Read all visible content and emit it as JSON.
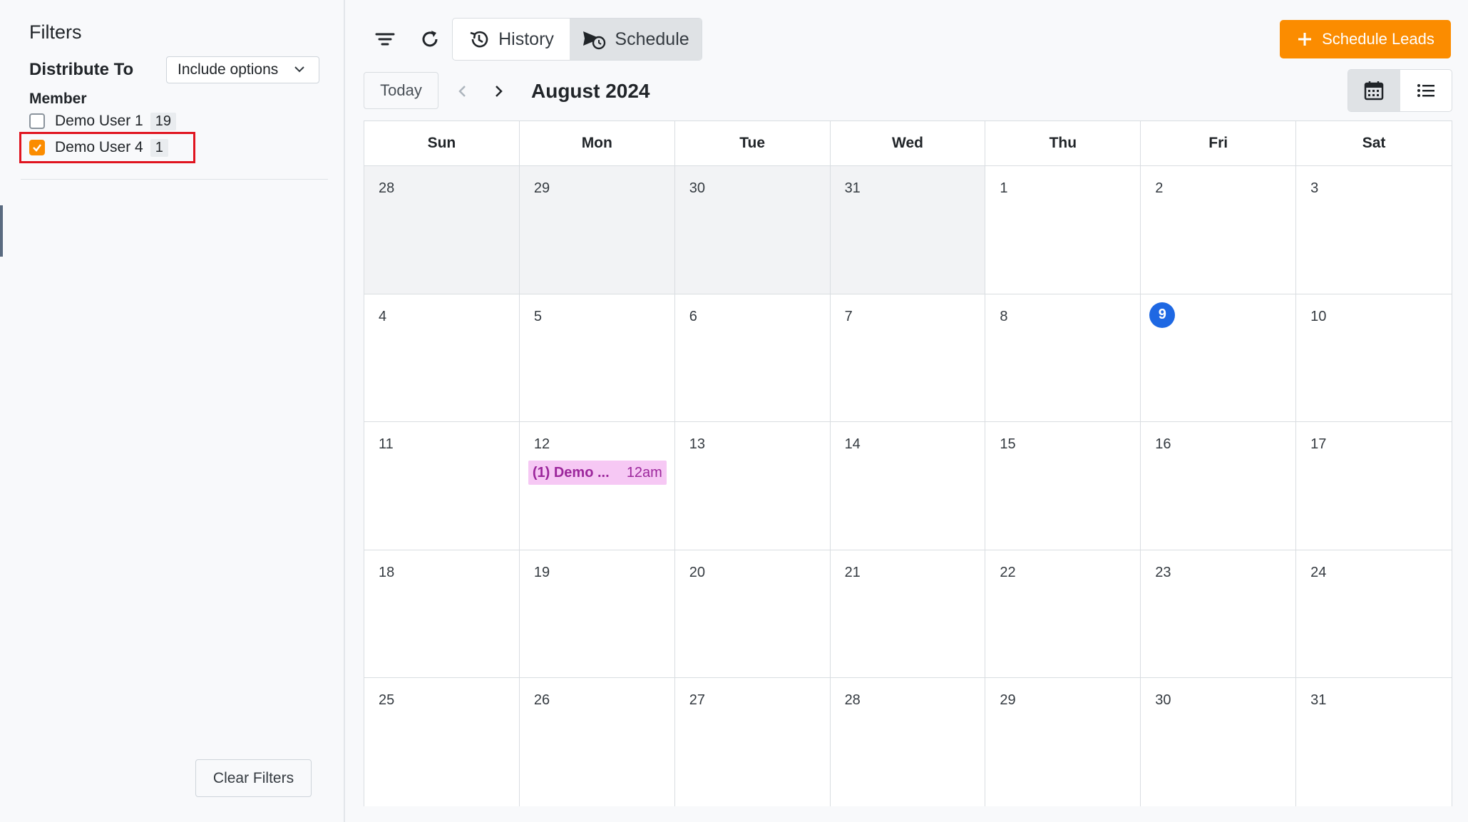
{
  "sidebar": {
    "title": "Filters",
    "distribute_label": "Distribute To",
    "include_dropdown": "Include options",
    "member_label": "Member",
    "members": [
      {
        "name": "Demo User 1",
        "count": "19",
        "checked": false
      },
      {
        "name": "Demo User 4",
        "count": "1",
        "checked": true
      }
    ],
    "clear_button": "Clear Filters"
  },
  "toolbar": {
    "history_label": "History",
    "schedule_label": "Schedule",
    "schedule_leads_label": "Schedule Leads",
    "today_label": "Today",
    "month_title": "August 2024"
  },
  "colors": {
    "accent": "#fb8c00",
    "today_circle": "#1e68e3",
    "event_bg": "#f6c8f4",
    "event_text": "#9c279c",
    "highlight": "#e0141f"
  },
  "calendar": {
    "weekdays": [
      "Sun",
      "Mon",
      "Tue",
      "Wed",
      "Thu",
      "Fri",
      "Sat"
    ],
    "today": "9",
    "weeks": [
      [
        {
          "d": "28",
          "other": true
        },
        {
          "d": "29",
          "other": true
        },
        {
          "d": "30",
          "other": true
        },
        {
          "d": "31",
          "other": true
        },
        {
          "d": "1"
        },
        {
          "d": "2"
        },
        {
          "d": "3"
        }
      ],
      [
        {
          "d": "4"
        },
        {
          "d": "5"
        },
        {
          "d": "6"
        },
        {
          "d": "7"
        },
        {
          "d": "8"
        },
        {
          "d": "9",
          "today": true
        },
        {
          "d": "10"
        }
      ],
      [
        {
          "d": "11"
        },
        {
          "d": "12"
        },
        {
          "d": "13"
        },
        {
          "d": "14"
        },
        {
          "d": "15"
        },
        {
          "d": "16"
        },
        {
          "d": "17"
        }
      ],
      [
        {
          "d": "18"
        },
        {
          "d": "19"
        },
        {
          "d": "20"
        },
        {
          "d": "21"
        },
        {
          "d": "22"
        },
        {
          "d": "23"
        },
        {
          "d": "24"
        }
      ],
      [
        {
          "d": "25"
        },
        {
          "d": "26"
        },
        {
          "d": "27"
        },
        {
          "d": "28"
        },
        {
          "d": "29"
        },
        {
          "d": "30"
        },
        {
          "d": "31"
        }
      ]
    ],
    "events": [
      {
        "week": 2,
        "day": 1,
        "title": "(1) Demo ...",
        "time": "12am"
      }
    ]
  }
}
